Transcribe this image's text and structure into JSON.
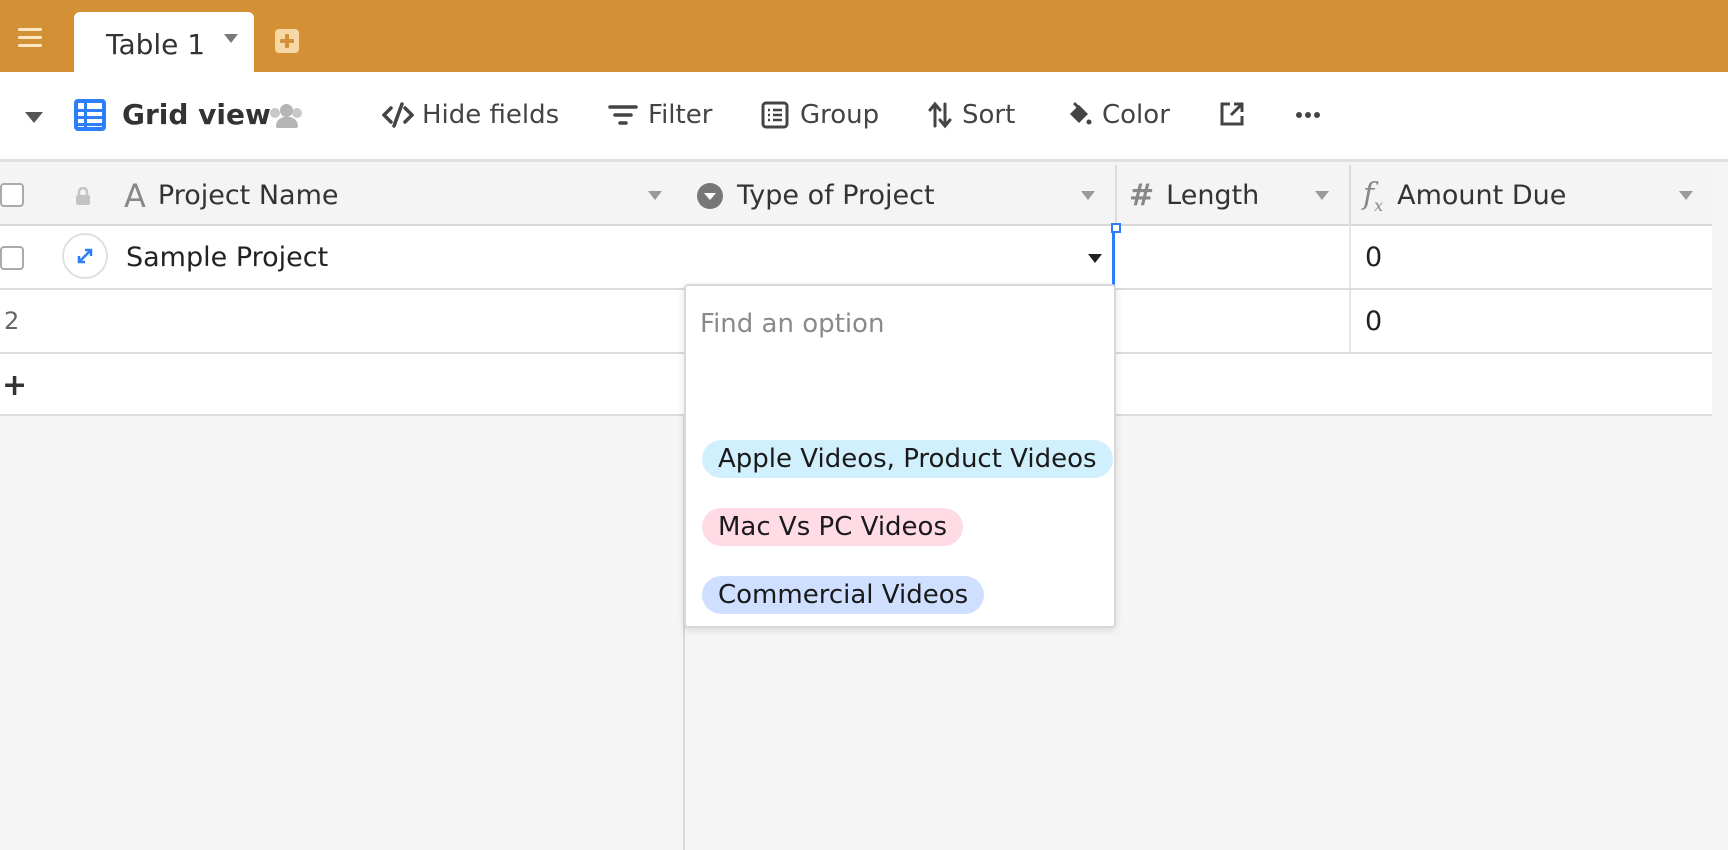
{
  "topbar": {
    "table_tab_label": "Table 1"
  },
  "toolbar": {
    "view_name": "Grid view",
    "hide_fields_label": "Hide fields",
    "filter_label": "Filter",
    "group_label": "Group",
    "sort_label": "Sort",
    "color_label": "Color"
  },
  "grid": {
    "columns": [
      {
        "label": "Project Name",
        "icon": "text-field-icon"
      },
      {
        "label": "Type of Project",
        "icon": "single-select-icon"
      },
      {
        "label": "Length",
        "icon": "number-hash-icon"
      },
      {
        "label": "Amount Due",
        "icon": "formula-icon"
      }
    ],
    "rows": [
      {
        "project_name": "Sample Project",
        "type_of_project": "",
        "length": "",
        "amount_due": "0"
      },
      {
        "row_number": "2",
        "project_name": "",
        "type_of_project": "",
        "length": "",
        "amount_due": "0"
      }
    ],
    "add_row_label": "+"
  },
  "dropdown": {
    "search_placeholder": "Find an option",
    "options": [
      {
        "label": "Apple Videos, Product Videos",
        "color": "#d0f0fd"
      },
      {
        "label": "Mac Vs PC Videos",
        "color": "#ffdce5"
      },
      {
        "label": "Commercial Videos",
        "color": "#cfdfff"
      }
    ]
  },
  "colors": {
    "topbar": "#d39034",
    "accent_blue": "#2d7ff9"
  }
}
